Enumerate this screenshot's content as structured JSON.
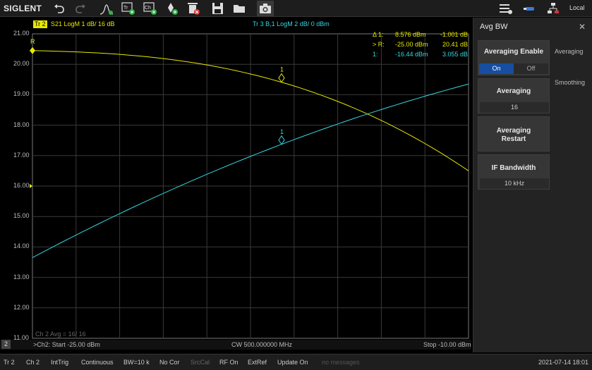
{
  "toolbar": {
    "brand": "SIGLENT",
    "buttons": [
      "undo-icon",
      "redo-icon",
      "marker-search-icon",
      "add-trace-icon",
      "add-channel-icon",
      "add-marker-icon",
      "delete-icon",
      "save-icon",
      "open-folder-icon",
      "camera-icon"
    ],
    "right_label": "Local"
  },
  "trace_header": {
    "tr2_badge": "Tr 2",
    "tr2_desc": "S21  LogM  1 dB/  16 dB",
    "tr3_desc": "Tr 3   B,1  LogM  2 dB/  0 dBm",
    "colors": {
      "tr2": "#e8e800",
      "tr3": "#35d8e0"
    }
  },
  "marker_table": {
    "rows": [
      {
        "label": "Δ 1:",
        "value1": "8.576 dBm",
        "value2": "-1.001 dB",
        "color": "#e8e800"
      },
      {
        "label": "> R:",
        "value1": "-25.00 dBm",
        "value2": "20.41 dB",
        "color": "#e8e800"
      },
      {
        "label": "1:",
        "value1": "-16.44 dBm",
        "value2": "3.055 dB",
        "color": "#35d8e0"
      }
    ]
  },
  "plot": {
    "y_labels": [
      "21.00",
      "20.00",
      "19.00",
      "18.00",
      "17.00",
      "16.00",
      "15.00",
      "14.00",
      "13.00",
      "12.00",
      "11.00"
    ],
    "ref_marker": "R",
    "marker1_label_yellow": "1",
    "marker1_label_cyan": "1",
    "avg_text": "Ch 2  Avg = 16/ 16"
  },
  "status_line": {
    "ch_badge": "2",
    "start": ">Ch2: Start -25.00 dBm",
    "center": "CW 500.000000 MHz",
    "stop": "Stop -10.00 dBm"
  },
  "panel": {
    "title": "Avg BW",
    "close": "✕",
    "cards": {
      "averaging_enable": {
        "title": "Averaging Enable",
        "on": "On",
        "off": "Off"
      },
      "averaging": {
        "title": "Averaging",
        "value": "16"
      },
      "averaging_restart": {
        "title_line1": "Averaging",
        "title_line2": "Restart"
      },
      "if_bandwidth": {
        "title": "IF Bandwidth",
        "value": "10 kHz"
      }
    },
    "side_tabs": {
      "averaging": "Averaging",
      "smoothing": "Smoothing"
    }
  },
  "bottom_bar": {
    "items": [
      "Tr 2",
      "Ch 2",
      "IntTrig",
      "Continuous",
      "BW=10 k",
      "No Cor",
      "SrcCal",
      "RF On",
      "ExtRef",
      "Update On",
      "no messages"
    ],
    "datetime": "2021-07-14 18:01"
  }
}
